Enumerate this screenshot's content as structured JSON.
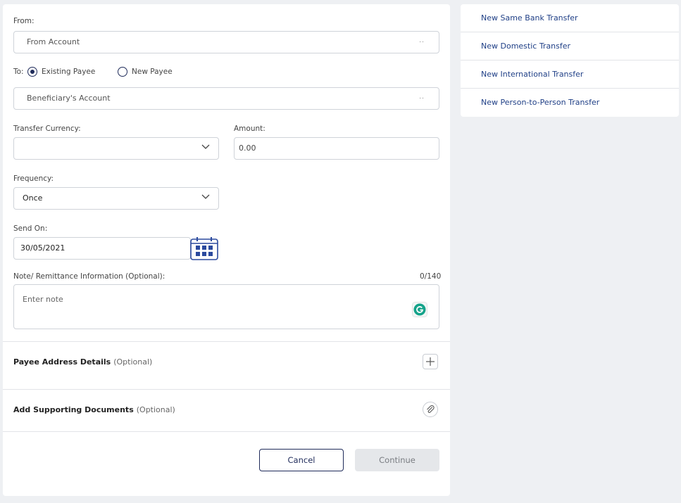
{
  "form": {
    "from_label": "From:",
    "from_placeholder": "From Account",
    "select_dots": "..",
    "to_label": "To:",
    "existing_payee_label": "Existing Payee",
    "new_payee_label": "New Payee",
    "beneficiary_placeholder": "Beneficiary's Account",
    "currency_label": "Transfer Currency:",
    "currency_value": "",
    "amount_label": "Amount:",
    "amount_value": "0.00",
    "frequency_label": "Frequency:",
    "frequency_value": "Once",
    "send_on_label": "Send On:",
    "send_on_value": "30/05/2021",
    "note_label": "Note/ Remittance Information (Optional):",
    "note_counter": "0/140",
    "note_placeholder": "Enter note",
    "payee_address_title": "Payee Address Details",
    "payee_address_optional": "(Optional)",
    "documents_title": "Add Supporting Documents",
    "documents_optional": "(Optional)",
    "cancel_label": "Cancel",
    "continue_label": "Continue"
  },
  "sidebar": {
    "items": [
      {
        "label": "New Same Bank Transfer"
      },
      {
        "label": "New Domestic Transfer"
      },
      {
        "label": "New International Transfer"
      },
      {
        "label": "New Person-to-Person Transfer"
      }
    ]
  },
  "colors": {
    "primary": "#1f2b5a",
    "link": "#1f3f86",
    "calendar": "#2b4a9e",
    "grammarly": "#15a38a",
    "page_bg": "#eef0f3"
  },
  "icons": {
    "calendar": "calendar-icon",
    "dropdown": "chevron-down-icon",
    "add": "plus-icon",
    "attach": "paperclip-icon",
    "grammarly": "grammarly-icon"
  }
}
